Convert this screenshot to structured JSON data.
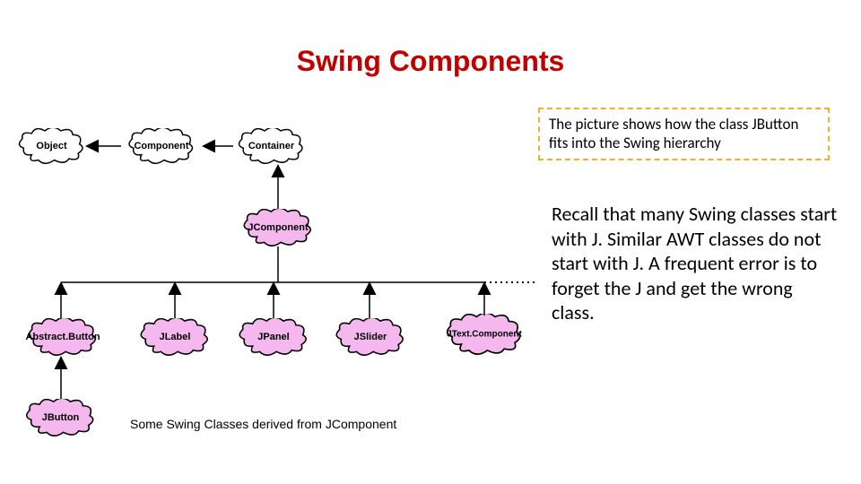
{
  "title": "Swing Components",
  "nodes": {
    "object": "Object",
    "component": "Component",
    "container": "Container",
    "jcomponent": "JComponent",
    "abstractbutton": "Abstract.Button",
    "jlabel": "JLabel",
    "jpanel": "JPanel",
    "jslider": "JSlider",
    "jtextcomponent": "JText.Component",
    "jbutton": "JButton"
  },
  "caption": "Some Swing Classes derived from JComponent",
  "annotation": "The picture shows how the class JButton fits into the Swing hierarchy",
  "body": "Recall that many Swing classes start with J. Similar AWT classes do not start with J. A frequent error is to forget the J and get the wrong class."
}
